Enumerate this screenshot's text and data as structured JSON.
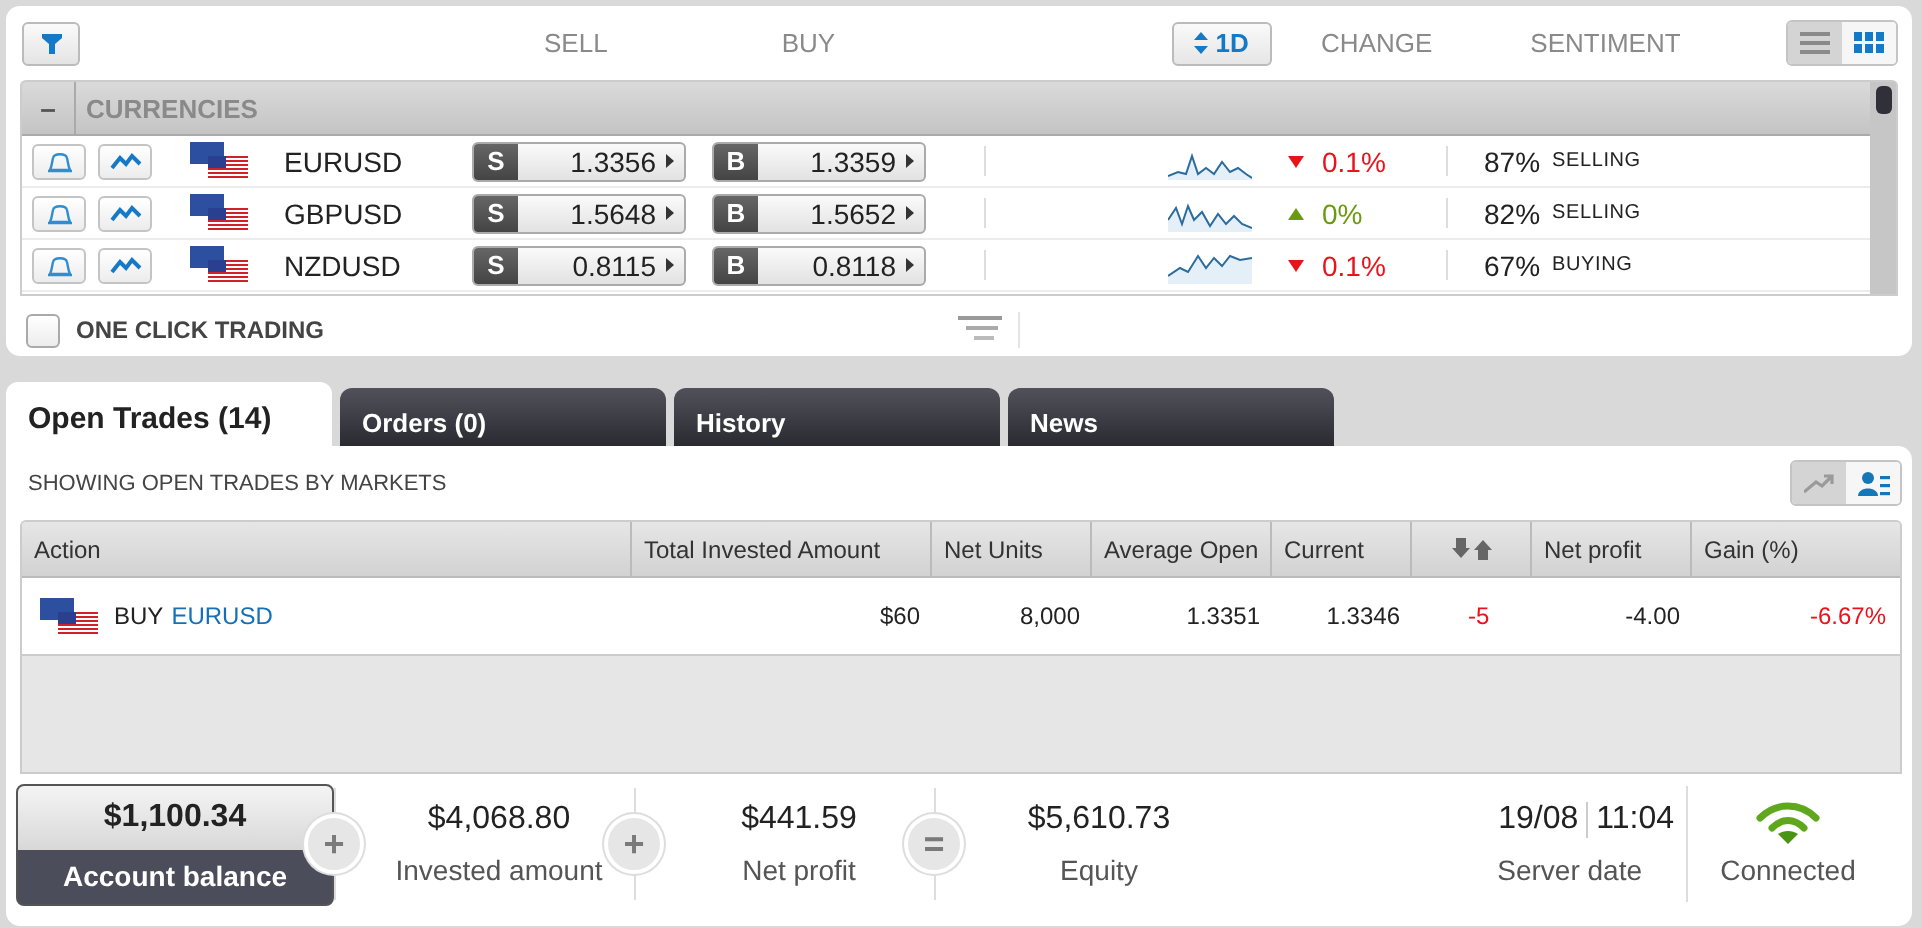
{
  "toolbar": {
    "sell_label": "SELL",
    "buy_label": "BUY",
    "period": "1D",
    "change_label": "CHANGE",
    "sentiment_label": "SENTIMENT",
    "view_toggle": [
      {
        "kind": "list",
        "selected": false
      },
      {
        "kind": "grid",
        "selected": true
      }
    ]
  },
  "category": {
    "toggle": "–",
    "name": "CURRENCIES"
  },
  "markets": [
    {
      "symbol": "EURUSD",
      "sell_letter": "S",
      "sell": "1.3356",
      "buy_letter": "B",
      "buy": "1.3359",
      "falling": true,
      "change": "0.1%",
      "sentiment_pct": "87%",
      "sentiment": "SELLING"
    },
    {
      "symbol": "GBPUSD",
      "sell_letter": "S",
      "sell": "1.5648",
      "buy_letter": "B",
      "buy": "1.5652",
      "falling": false,
      "change": "0%",
      "sentiment_pct": "82%",
      "sentiment": "SELLING"
    },
    {
      "symbol": "NZDUSD",
      "sell_letter": "S",
      "sell": "0.8115",
      "buy_letter": "B",
      "buy": "0.8118",
      "falling": true,
      "change": "0.1%",
      "sentiment_pct": "67%",
      "sentiment": "BUYING"
    }
  ],
  "one_click_trading": {
    "label": "ONE CLICK TRADING",
    "checked": false
  },
  "tabs": [
    {
      "label": "Open Trades (14)",
      "selected": true
    },
    {
      "label": "Orders (0)",
      "selected": false
    },
    {
      "label": "History",
      "selected": false
    },
    {
      "label": "News",
      "selected": false
    }
  ],
  "trades": {
    "subtitle": "SHOWING OPEN TRADES BY MARKETS",
    "view_toggle": [
      {
        "kind": "chart",
        "selected": false
      },
      {
        "kind": "people",
        "selected": true
      }
    ],
    "columns": [
      {
        "kind": "text",
        "label": "Action"
      },
      {
        "kind": "text",
        "label": "Total Invested Amount"
      },
      {
        "kind": "text",
        "label": "Net Units"
      },
      {
        "kind": "text",
        "label": "Average Open"
      },
      {
        "kind": "text",
        "label": "Current"
      },
      {
        "kind": "icon"
      },
      {
        "kind": "text",
        "label": "Net profit"
      },
      {
        "kind": "text",
        "label": "Gain (%)"
      }
    ],
    "rows": [
      {
        "action": "BUY",
        "market": "EURUSD",
        "invested": "$60",
        "units": "8,000",
        "average_open": "1.3351",
        "current": "1.3346",
        "pips": "-5",
        "net_profit": "-4.00",
        "gain": "-6.67%",
        "loss": true
      }
    ]
  },
  "footer": {
    "balance": {
      "value": "$1,100.34",
      "label": "Account balance"
    },
    "summary": [
      {
        "operator": "+",
        "value": "$4,068.80",
        "label": "Invested amount"
      },
      {
        "operator": "+",
        "value": "$441.59",
        "label": "Net profit"
      },
      {
        "operator": "=",
        "value": "$5,610.73",
        "label": "Equity"
      }
    ],
    "server": {
      "date": "19/08",
      "time": "11:04",
      "label": "Server date"
    },
    "connection": {
      "label": "Connected",
      "connected": true
    }
  }
}
